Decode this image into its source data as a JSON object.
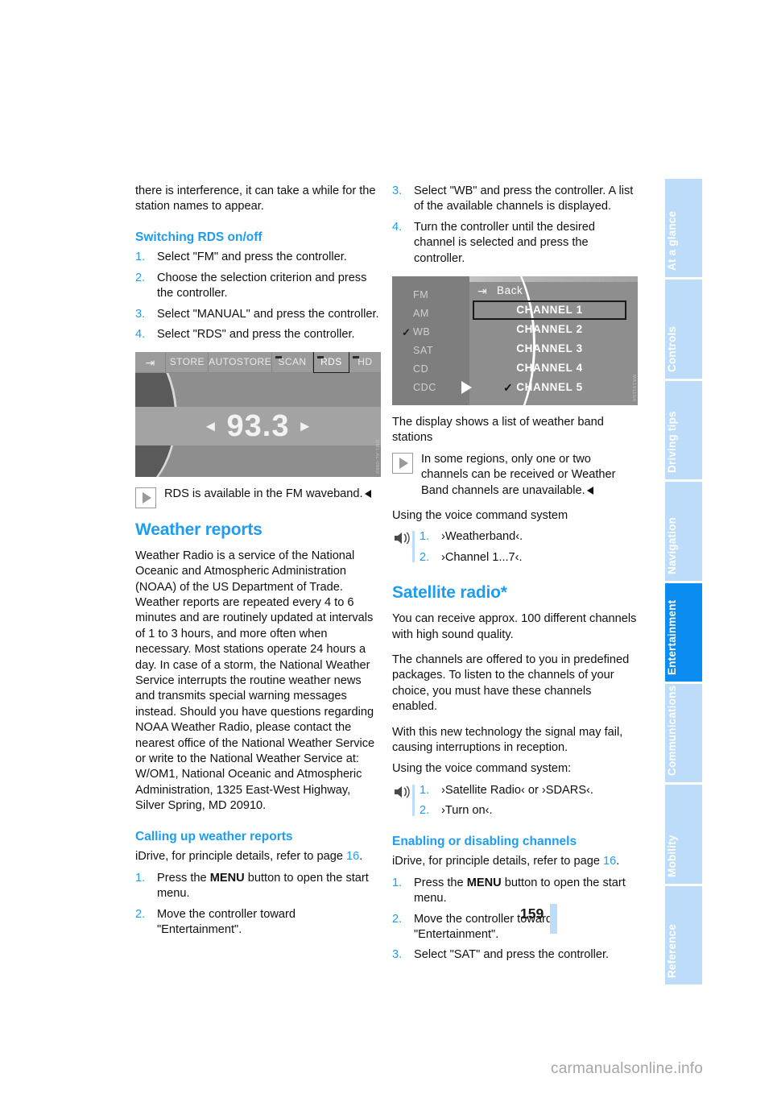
{
  "document": {
    "page_number": "159",
    "watermark": "carmanualsonline.info"
  },
  "sidebar": {
    "tabs": [
      {
        "label": "At a glance",
        "active": false
      },
      {
        "label": "Controls",
        "active": false
      },
      {
        "label": "Driving tips",
        "active": false
      },
      {
        "label": "Navigation",
        "active": false
      },
      {
        "label": "Entertainment",
        "active": true
      },
      {
        "label": "Communications",
        "active": false
      },
      {
        "label": "Mobility",
        "active": false
      },
      {
        "label": "Reference",
        "active": false
      }
    ],
    "colors": {
      "inactive_bg": "#bddcfa",
      "active_bg": "#0b8cf0",
      "label": "#ffffff"
    }
  },
  "left_column": {
    "continued_paragraph": "there is interference, it can take a while for the station names to appear.",
    "rds_heading": "Switching RDS on/off",
    "rds_steps": [
      "Select \"FM\" and press the controller.",
      "Choose the selection criterion and press the controller.",
      "Select \"MANUAL\" and press the controller.",
      "Select \"RDS\" and press the controller."
    ],
    "radio_screenshot": {
      "back_glyph": "back-arrow",
      "buttons": [
        "STORE",
        "AUTOSTORE",
        "SCAN",
        "RDS",
        "HD"
      ],
      "selected_button": "RDS",
      "frequency": "93.3",
      "left_arrow": "◂",
      "right_arrow": "▸",
      "code": "BM1-AL-0669"
    },
    "rds_note": "RDS is available in the FM waveband.",
    "weather_heading": "Weather reports",
    "weather_paragraph": "Weather Radio is a service of the National Oceanic and Atmospheric Administration (NOAA) of the US Department of Trade. Weather reports are repeated every 4 to 6 minutes and are routinely updated at intervals of 1 to 3 hours, and more often when necessary. Most stations operate 24 hours a day. In case of a storm, the National Weather Service interrupts the routine weather news and transmits special warning messages instead. Should you have questions regarding NOAA Weather Radio, please contact the nearest office of the National Weather Service or write to the National Weather Service at: W/OM1, National Oceanic and Atmospheric Administration, 1325 East-West Highway, Silver Spring, MD 20910.",
    "calling_heading": "Calling up weather reports",
    "idrive_ref_pre": "iDrive, for principle details, refer to page ",
    "idrive_ref_page": "16",
    "idrive_ref_post": ".",
    "calling_steps": [
      {
        "pre": "Press the ",
        "bold": "MENU",
        "post": " button to open the start menu."
      },
      {
        "pre": "",
        "bold": "",
        "post": "Move the controller toward \"Entertainment\"."
      }
    ]
  },
  "right_column": {
    "top_steps": [
      {
        "num": "3.",
        "text": "Select \"WB\" and press the controller. A list of the available channels is displayed."
      },
      {
        "num": "4.",
        "text": "Turn the controller until the desired channel is selected and press the controller."
      }
    ],
    "wb_screenshot": {
      "bands": [
        {
          "label": "FM",
          "checked": false
        },
        {
          "label": "AM",
          "checked": false
        },
        {
          "label": "WB",
          "checked": true
        },
        {
          "label": "SAT",
          "checked": false
        },
        {
          "label": "CD",
          "checked": false
        },
        {
          "label": "CDC",
          "checked": false
        }
      ],
      "back_label": "Back",
      "channels": [
        {
          "label": "CHANNEL 1",
          "selected": true,
          "checked": false
        },
        {
          "label": "CHANNEL 2",
          "selected": false,
          "checked": false
        },
        {
          "label": "CHANNEL 3",
          "selected": false,
          "checked": false
        },
        {
          "label": "CHANNEL 4",
          "selected": false,
          "checked": false
        },
        {
          "label": "CHANNEL 5",
          "selected": false,
          "checked": true
        }
      ],
      "code": "MK1911SA"
    },
    "display_caption": "The display shows a list of weather band stations",
    "region_note": "In some regions, only one or two channels can be received or Weather Band channels are unavailable.",
    "voice_heading_wb": "Using the voice command system",
    "voice_steps_wb": [
      "›Weatherband‹.",
      "›Channel 1...7‹."
    ],
    "satellite_heading": "Satellite radio*",
    "satellite_paragraphs": [
      "You can receive approx. 100 different channels with high sound quality.",
      "The channels are offered to you in predefined packages. To listen to the channels of your choice, you must have these channels enabled.",
      "With this new technology the signal may fail, causing interruptions in reception."
    ],
    "voice_heading_sat": "Using the voice command system:",
    "voice_steps_sat": [
      "›Satellite Radio‹ or ›SDARS‹.",
      "›Turn on‹."
    ],
    "enabling_heading": "Enabling or disabling channels",
    "idrive_ref_pre": "iDrive, for principle details, refer to page ",
    "idrive_ref_page": "16",
    "idrive_ref_post": ".",
    "enabling_steps": [
      {
        "pre": "Press the ",
        "bold": "MENU",
        "post": " button to open the start menu."
      },
      {
        "pre": "",
        "bold": "",
        "post": "Move the controller toward \"Entertainment\"."
      },
      {
        "pre": "",
        "bold": "",
        "post": "Select \"SAT\" and press the controller."
      }
    ]
  },
  "colors": {
    "accent_blue": "#1f9cf0",
    "tab_light": "#bddcfa",
    "tab_active": "#0b8cf0"
  }
}
